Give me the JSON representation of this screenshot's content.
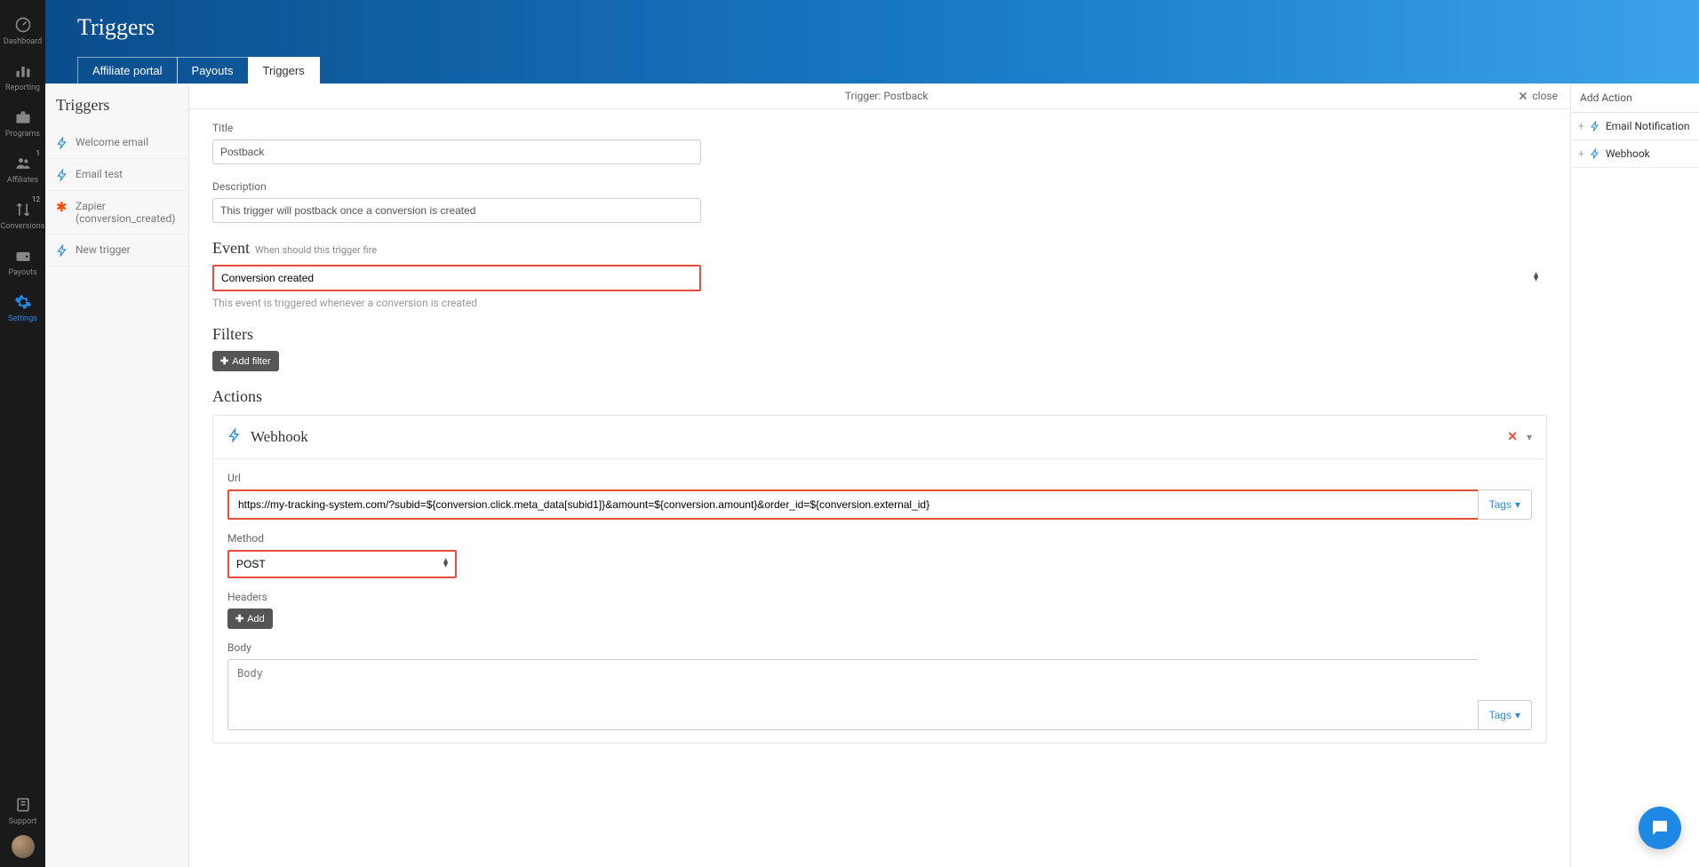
{
  "nav": [
    {
      "key": "dashboard",
      "label": "Dashboard",
      "badge": ""
    },
    {
      "key": "reporting",
      "label": "Reporting",
      "badge": ""
    },
    {
      "key": "programs",
      "label": "Programs",
      "badge": ""
    },
    {
      "key": "affiliates",
      "label": "Affiliates",
      "badge": "1"
    },
    {
      "key": "conversions",
      "label": "Conversions",
      "badge": "12"
    },
    {
      "key": "payouts",
      "label": "Payouts",
      "badge": ""
    },
    {
      "key": "settings",
      "label": "Settings",
      "badge": ""
    }
  ],
  "nav_bottom": {
    "support": "Support"
  },
  "page": {
    "title": "Triggers"
  },
  "tabs": {
    "portal": "Affiliate portal",
    "payouts": "Payouts",
    "triggers": "Triggers"
  },
  "triggers_sidebar": {
    "title": "Triggers",
    "items": [
      {
        "label": "Welcome email",
        "icon": "lightning"
      },
      {
        "label": "Email test",
        "icon": "lightning"
      },
      {
        "label": "Zapier (conversion_created)",
        "icon": "zapier"
      },
      {
        "label": "New trigger",
        "icon": "lightning"
      }
    ]
  },
  "editor": {
    "header_title": "Trigger: Postback",
    "close_label": "close",
    "title_label": "Title",
    "title_value": "Postback",
    "description_label": "Description",
    "description_value": "This trigger will postback once a conversion is created",
    "event_label": "Event",
    "event_sub": "When should this trigger fire",
    "event_value": "Conversion created",
    "event_helper": "This event is triggered whenever a conversion is created",
    "filters_label": "Filters",
    "add_filter": "Add filter",
    "actions_label": "Actions"
  },
  "webhook": {
    "title": "Webhook",
    "url_label": "Url",
    "url_value": "https://my-tracking-system.com/?subid=${conversion.click.meta_data[subid1]}&amount=${conversion.amount}&order_id=${conversion.external_id}",
    "tags_label": "Tags",
    "method_label": "Method",
    "method_value": "POST",
    "headers_label": "Headers",
    "add_header": "Add",
    "body_label": "Body",
    "body_placeholder": "Body"
  },
  "action_panel": {
    "title": "Add Action",
    "items": [
      {
        "label": "Email Notification"
      },
      {
        "label": "Webhook"
      }
    ]
  }
}
